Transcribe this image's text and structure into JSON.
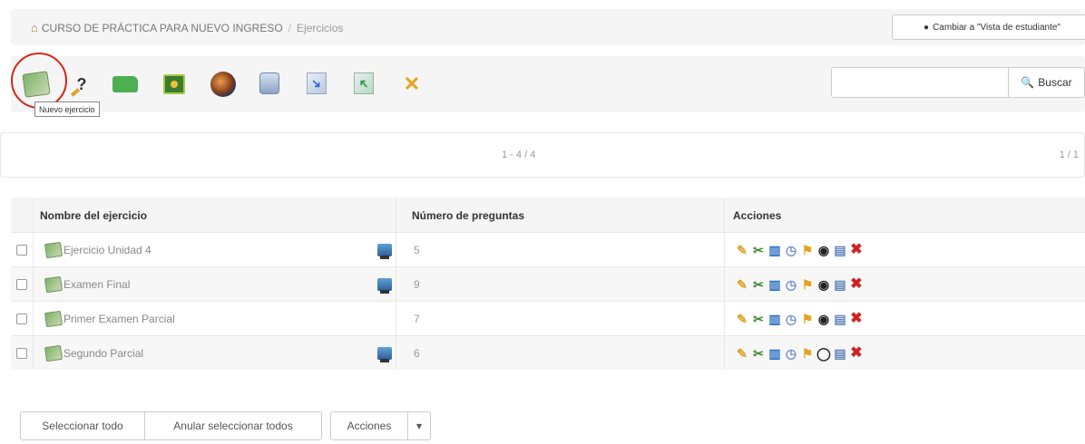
{
  "breadcrumb": {
    "course": "CURSO DE PRÁCTICA PARA NUEVO INGRESO",
    "separator": "/",
    "current": "Ejercicios"
  },
  "student_view_button": "Cambiar a \"Vista de estudiante\"",
  "toolbar": {
    "icons": [
      "new-exercise-icon",
      "question-pool-icon",
      "folder-icon",
      "calendar-icon",
      "globe-icon",
      "disk-icon",
      "export-icon",
      "import-icon",
      "clean-icon"
    ],
    "tooltip": "Nuevo ejercicio"
  },
  "search": {
    "placeholder": "",
    "button_label": "Buscar"
  },
  "pager": {
    "range": "1 - 4 / 4",
    "pages": "1 / 1"
  },
  "table": {
    "headers": {
      "name": "Nombre del ejercicio",
      "questions": "Número de preguntas",
      "actions": "Acciones"
    },
    "rows": [
      {
        "name": "Ejercicio Unidad 4",
        "questions": "5",
        "shared": true,
        "visible": true
      },
      {
        "name": "Examen Final",
        "questions": "9",
        "shared": true,
        "visible": true
      },
      {
        "name": "Primer Examen Parcial",
        "questions": "7",
        "shared": false,
        "visible": true
      },
      {
        "name": "Segundo Parcial",
        "questions": "6",
        "shared": true,
        "visible": false
      }
    ]
  },
  "bottom_buttons": {
    "select_all": "Seleccionar todo",
    "unselect_all": "Anular seleccionar todos",
    "actions": "Acciones",
    "caret": "▾"
  },
  "colors": {
    "highlight": "#d9231a",
    "delete": "#d12222"
  }
}
